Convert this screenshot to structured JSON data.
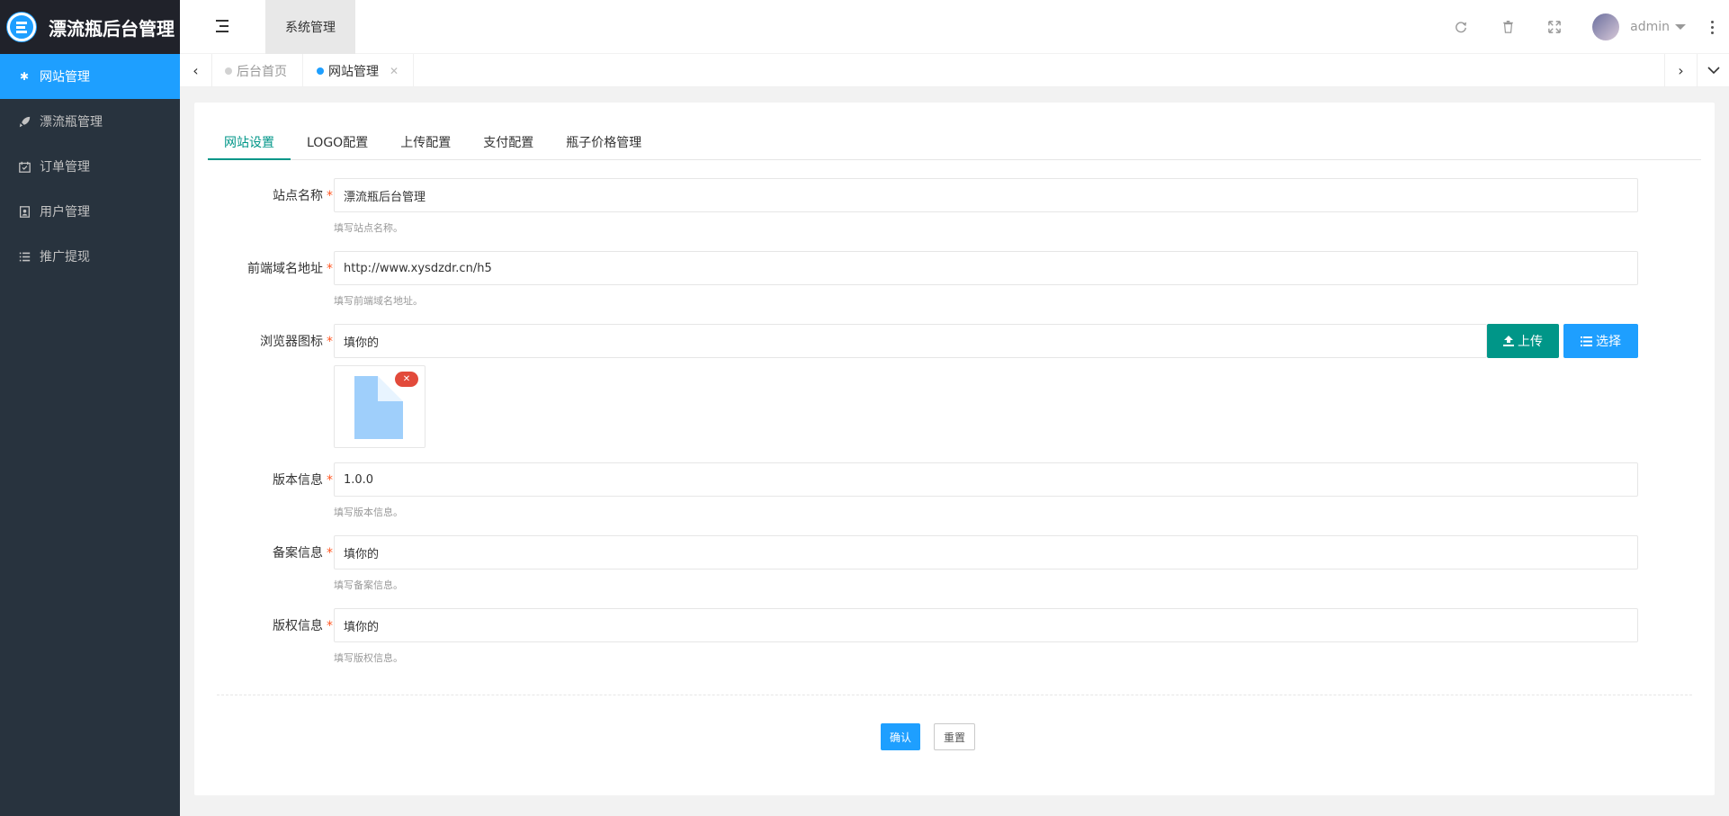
{
  "app": {
    "title": "漂流瓶后台管理"
  },
  "sidebar": {
    "items": [
      {
        "label": "网站管理",
        "icon": "gear-icon",
        "active": true
      },
      {
        "label": "漂流瓶管理",
        "icon": "rocket-icon",
        "active": false
      },
      {
        "label": "订单管理",
        "icon": "calendar-check-icon",
        "active": false
      },
      {
        "label": "用户管理",
        "icon": "user-card-icon",
        "active": false
      },
      {
        "label": "推广提现",
        "icon": "list-icon",
        "active": false
      }
    ]
  },
  "header": {
    "tab": "系统管理",
    "username": "admin",
    "icons": [
      "refresh-icon",
      "trash-icon",
      "fullscreen-icon",
      "more-vertical-icon"
    ]
  },
  "page_tabs": [
    {
      "label": "后台首页",
      "active": false
    },
    {
      "label": "网站管理",
      "active": true,
      "closable": true
    }
  ],
  "sub_tabs": [
    {
      "label": "网站设置",
      "active": true
    },
    {
      "label": "LOGO配置",
      "active": false
    },
    {
      "label": "上传配置",
      "active": false
    },
    {
      "label": "支付配置",
      "active": false
    },
    {
      "label": "瓶子价格管理",
      "active": false
    }
  ],
  "form": {
    "site_name": {
      "label": "站点名称",
      "value": "漂流瓶后台管理",
      "help": "填写站点名称。"
    },
    "domain": {
      "label": "前端域名地址",
      "value": "http://www.xysdzdr.cn/h5",
      "help": "填写前端域名地址。"
    },
    "favicon": {
      "label": "浏览器图标",
      "value": "填你的",
      "upload_label": "上传",
      "choose_label": "选择"
    },
    "version": {
      "label": "版本信息",
      "value": "1.0.0",
      "help": "填写版本信息。"
    },
    "icp": {
      "label": "备案信息",
      "value": "填你的",
      "help": "填写备案信息。"
    },
    "copyright": {
      "label": "版权信息",
      "value": "填你的",
      "help": "填写版权信息。"
    },
    "required_mark": "*"
  },
  "actions": {
    "confirm": "确认",
    "reset": "重置"
  },
  "colors": {
    "accent": "#1e9fff",
    "sidebar": "#28333e",
    "tab_active": "#009688",
    "upload": "#009688",
    "required": "#ff5722"
  }
}
